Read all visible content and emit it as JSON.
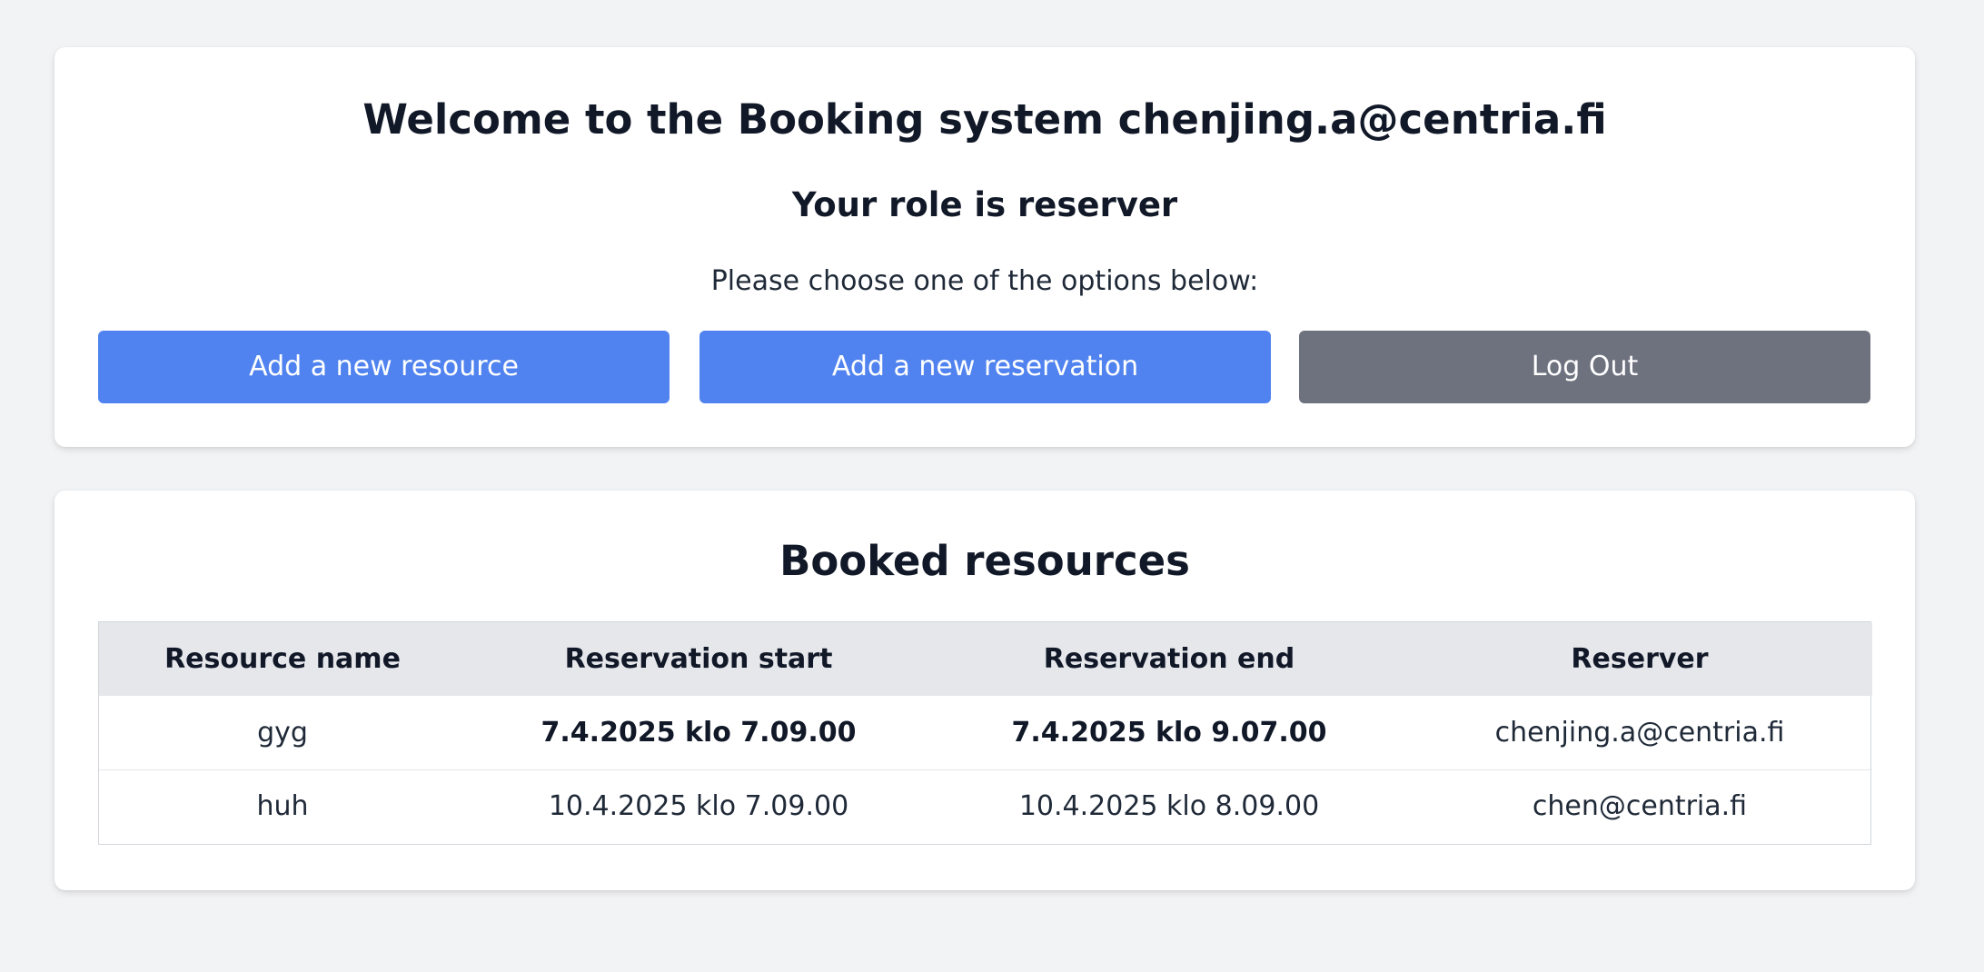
{
  "welcome": {
    "title": "Welcome to the Booking system chenjing.a@centria.fi",
    "role_text": "Your role is reserver",
    "prompt": "Please choose one of the options below:",
    "buttons": {
      "add_resource": "Add a new resource",
      "add_reservation": "Add a new reservation",
      "logout": "Log Out"
    }
  },
  "booked": {
    "title": "Booked resources",
    "columns": [
      "Resource name",
      "Reservation start",
      "Reservation end",
      "Reserver"
    ],
    "rows": [
      {
        "resource": "gyg",
        "start": "7.4.2025 klo 7.09.00",
        "end": "7.4.2025 klo 9.07.00",
        "reserver": "chenjing.a@centria.fi"
      },
      {
        "resource": "huh",
        "start": "10.4.2025 klo 7.09.00",
        "end": "10.4.2025 klo 8.09.00",
        "reserver": "chen@centria.fi"
      }
    ]
  },
  "colors": {
    "background": "#f2f3f5",
    "primary_button": "#5083ef",
    "secondary_button": "#6e727f",
    "table_header": "#e5e7eb"
  }
}
